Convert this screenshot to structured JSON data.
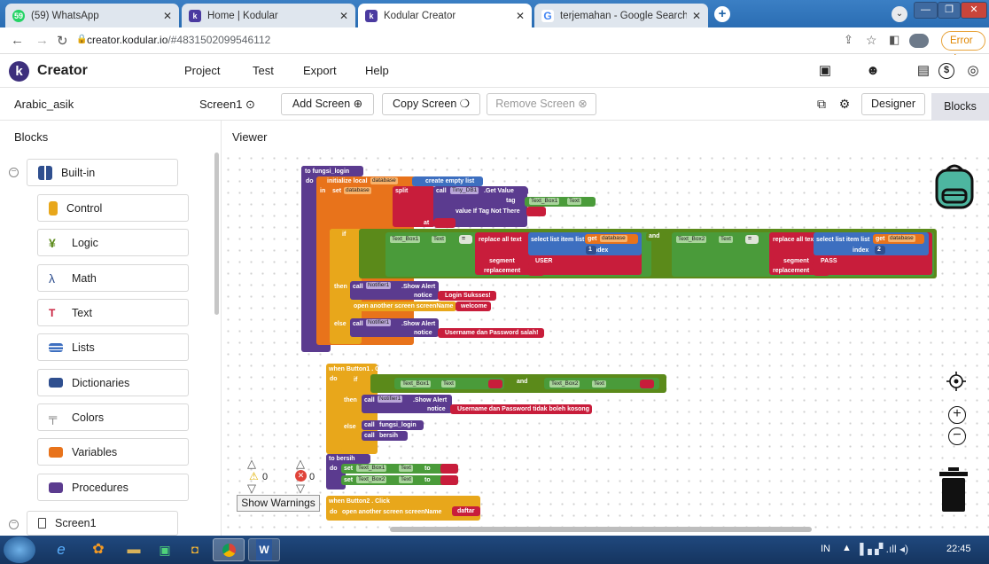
{
  "browser": {
    "tabs": [
      {
        "title": "(59) WhatsApp",
        "badge": "59",
        "active": false
      },
      {
        "title": "Home | Kodular",
        "active": false
      },
      {
        "title": "Kodular Creator",
        "active": true
      },
      {
        "title": "terjemahan - Google Search",
        "active": false
      }
    ],
    "url_host": "creator.kodular.io",
    "url_path": "/#4831502099546112",
    "error_label": "Error"
  },
  "app": {
    "brand": "Creator",
    "menu": [
      "Project",
      "Test",
      "Export",
      "Help"
    ],
    "project_name": "Arabic_asik",
    "screen_select": "Screen1",
    "add_screen": "Add Screen ⊕",
    "copy_screen": "Copy Screen ❍",
    "remove_screen": "Remove Screen ⊗",
    "designer_label": "Designer",
    "blocks_label": "Blocks"
  },
  "panels": {
    "blocks_title": "Blocks",
    "viewer_title": "Viewer"
  },
  "blocks_tree": {
    "builtin": "Built-in",
    "items": [
      "Control",
      "Logic",
      "Math",
      "Text",
      "Lists",
      "Dictionaries",
      "Colors",
      "Variables",
      "Procedures"
    ],
    "screen": "Screen1"
  },
  "warnings": {
    "warn_count": "0",
    "error_count": "0",
    "show_warnings": "Show Warnings"
  },
  "blocks_code": {
    "proc1": "to fungsi_login",
    "do": "do",
    "init_local": "initialize local",
    "database": "database",
    "to": "to",
    "create_empty": "create empty list",
    "in": "in",
    "set": "set",
    "split": "split",
    "text": "text",
    "call": "call",
    "tiny_db": "Tiny_DB1",
    "get_value": ".Get Value",
    "tag": "tag",
    "text_box1": "Text_Box1",
    "text_prop": "Text",
    "value_if": "value If Tag Not There",
    "at": "at",
    "if": "if",
    "then": "then",
    "else": "else",
    "and": "and",
    "replace_all": "replace all text",
    "select_list": "select list item  list",
    "get": "get",
    "index": "index",
    "index1": "1",
    "index2": "2",
    "segment": "segment",
    "user": "USER",
    "pass": "PASS",
    "replacement": "replacement",
    "text_box2": "Text_Box2",
    "notifier": "Notifier1",
    "show_alert": ".Show Alert",
    "notice": "notice",
    "login_sukses": "Login Suksses!",
    "open_screen": "open another screen  screenName",
    "welcome": "welcome",
    "salah": "Username dan Password salah!",
    "when_button1": "when  Button1 . Click",
    "kosong": "Username dan Password tidak boleh kosong",
    "fungsi_login": "fungsi_login",
    "bersih": "bersih",
    "proc2": "to bersih",
    "when_button2": "when  Button2 . Click",
    "daftar": "daftar"
  },
  "taskbar": {
    "lang": "IN",
    "time": "22:45"
  }
}
